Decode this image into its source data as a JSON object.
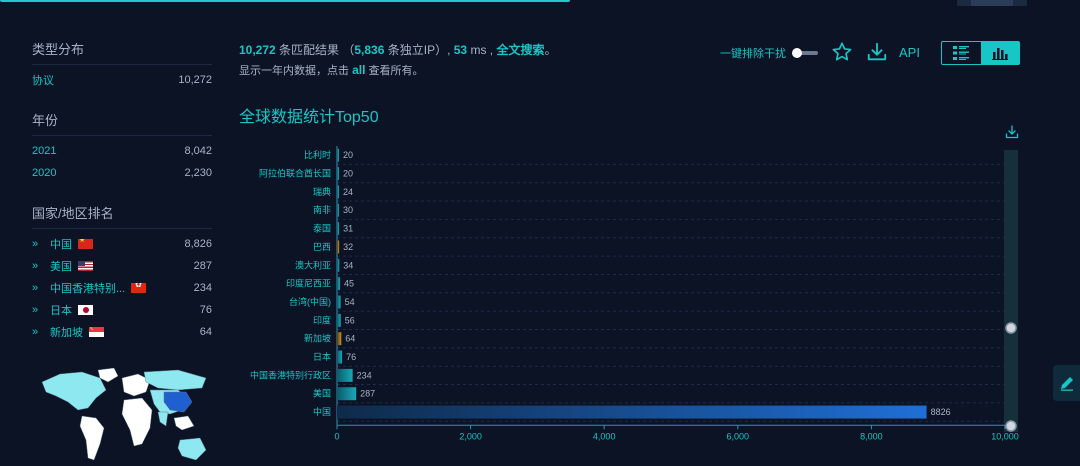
{
  "summary": {
    "total": "10,272",
    "total_suffix": " 条匹配结果 （",
    "unique_ip": "5,836",
    "unique_ip_suffix": " 条独立IP）, ",
    "ms": "53",
    "ms_suffix": " ms , ",
    "fulltext_link": "全文搜索",
    "end": "。"
  },
  "subline": {
    "prefix": "显示一年内数据，点击 ",
    "all_link": "all",
    "suffix": " 查看所有。"
  },
  "toolbar": {
    "noise_label": "一键排除干扰",
    "api_label": "API",
    "noise_toggle_on": false
  },
  "sidebar": {
    "type_title": "类型分布",
    "types": [
      {
        "label": "协议",
        "count": "10,272"
      }
    ],
    "year_title": "年份",
    "years": [
      {
        "label": "2021",
        "count": "8,042"
      },
      {
        "label": "2020",
        "count": "2,230"
      }
    ],
    "country_title": "国家/地区排名",
    "countries": [
      {
        "label": "中国",
        "count": "8,826",
        "flag": "flag-cn"
      },
      {
        "label": "美国",
        "count": "287",
        "flag": "flag-us"
      },
      {
        "label": "中国香港特别...",
        "count": "234",
        "flag": "flag-hk"
      },
      {
        "label": "日本",
        "count": "76",
        "flag": "flag-jp"
      },
      {
        "label": "新加坡",
        "count": "64",
        "flag": "flag-sg"
      }
    ]
  },
  "colors": {
    "accent": "#19c6c6",
    "bar_main": "#1f6fd6",
    "bar_gold": "#c8962a"
  },
  "chart_data": {
    "type": "bar",
    "orientation": "horizontal",
    "title": "全球数据统计Top50",
    "categories": [
      "比利时",
      "阿拉伯联合酋长国",
      "瑞典",
      "南非",
      "泰国",
      "巴西",
      "澳大利亚",
      "印度尼西亚",
      "台湾(中国)",
      "印度",
      "新加坡",
      "日本",
      "中国香港特别行政区",
      "美国",
      "中国"
    ],
    "values": [
      20,
      20,
      24,
      30,
      31,
      32,
      34,
      45,
      54,
      56,
      64,
      76,
      234,
      287,
      8826
    ],
    "x_ticks": [
      "0",
      "2,000",
      "4,000",
      "6,000",
      "8,000",
      "10,000"
    ],
    "xlim": [
      0,
      10000
    ],
    "grid": true,
    "legend": "none"
  }
}
